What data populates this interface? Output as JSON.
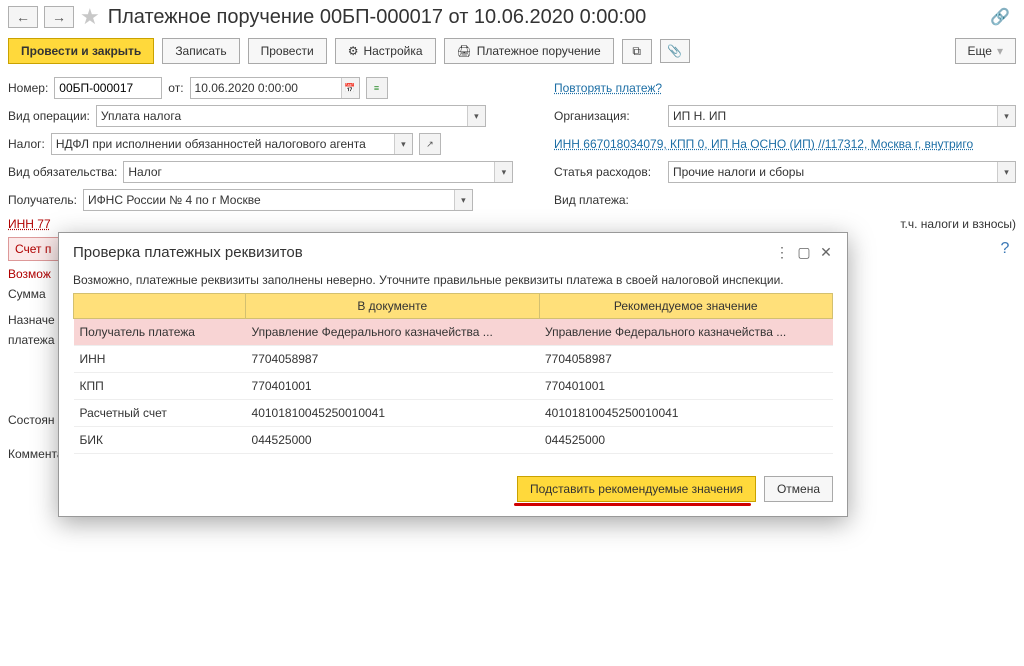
{
  "header": {
    "title": "Платежное поручение 00БП-000017 от 10.06.2020 0:00:00"
  },
  "toolbar": {
    "post_close": "Провести и закрыть",
    "save": "Записать",
    "post": "Провести",
    "settings": "Настройка",
    "print": "Платежное поручение",
    "more": "Еще"
  },
  "form": {
    "number_label": "Номер:",
    "number": "00БП-000017",
    "ot": "от:",
    "date": "10.06.2020  0:00:00",
    "repeat": "Повторять платеж?",
    "op_label": "Вид операции:",
    "op": "Уплата налога",
    "org_label": "Организация:",
    "org": "ИП Н. ИП",
    "tax_label": "Налог:",
    "tax": "НДФЛ при исполнении обязанностей налогового агента",
    "org_link": "ИНН 667018034079, КПП 0, ИП На ОСНО (ИП) //117312, Москва г, внутриго",
    "obl_label": "Вид обязательства:",
    "obl": "Налог",
    "expense_label": "Статья расходов:",
    "expense": "Прочие налоги и сборы",
    "recipient_label": "Получатель:",
    "recipient": "ИФНС России № 4 по г Москве",
    "paytype_label": "Вид платежа:",
    "inn77": "ИНН 77",
    "tax_inc": "т.ч. налоги и взносы)",
    "account_lbl": "Счет п",
    "possible": "Возмож",
    "sum_lbl": "Сумма",
    "purpose_lbl": "Назначе",
    "purpose2": "платежа",
    "state_lbl": "Состоян",
    "comment_lbl": "Комментарий:"
  },
  "dialog": {
    "title": "Проверка платежных реквизитов",
    "message": "Возможно, платежные реквизиты заполнены неверно. Уточните правильные реквизиты платежа в своей налоговой инспекции.",
    "col_doc": "В документе",
    "col_rec": "Рекомендуемое значение",
    "rows": [
      {
        "name": "Получатель платежа",
        "doc": "Управление Федерального казначейства ...",
        "rec": "Управление Федерального казначейства ...",
        "pink": true
      },
      {
        "name": "ИНН",
        "doc": "7704058987",
        "rec": "7704058987"
      },
      {
        "name": "КПП",
        "doc": "770401001",
        "rec": "770401001"
      },
      {
        "name": "Расчетный счет",
        "doc": "40101810045250010041",
        "rec": "40101810045250010041"
      },
      {
        "name": "БИК",
        "doc": "044525000",
        "rec": "044525000"
      }
    ],
    "apply": "Подставить рекомендуемые значения",
    "cancel": "Отмена"
  }
}
